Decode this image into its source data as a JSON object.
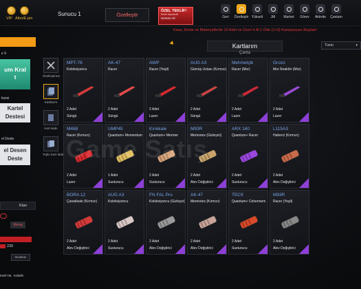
{
  "topbar": {
    "vip_label": "VIP",
    "currency_label": "Altın/E-pin",
    "server": "Sunucu 1",
    "customize": "Özelleştir",
    "offer": {
      "title": "ÖZEL TEKLİF!",
      "subtitle": "Kısıtlı Kapsamlı!",
      "action": "Hemen Al!"
    },
    "nav": [
      {
        "label": "Geri",
        "icon": "back-icon"
      },
      {
        "label": "Özelleştir",
        "icon": "crossed-tools-icon"
      },
      {
        "label": "Yükselt",
        "icon": "upgrade-icon"
      },
      {
        "label": "JM",
        "icon": "jm-icon"
      },
      {
        "label": "Market",
        "icon": "market-icon"
      },
      {
        "label": "Görev",
        "icon": "quest-icon"
      },
      {
        "label": "Aktivite",
        "icon": "activity-icon"
      },
      {
        "label": "Çantam",
        "icon": "bag-icon"
      }
    ]
  },
  "left": {
    "header_label": "e 9",
    "tile1": [
      "um Kral",
      "t"
    ],
    "section1": "ksesi",
    "tile2": [
      "Kartel",
      "Destesi"
    ],
    "section2": "el Deste",
    "tile3": [
      "el Desen",
      "Deste"
    ],
    "clan": "Klan",
    "message": "Mesaj",
    "stat1": "230",
    "stat2": "ÖLÜM M.",
    "foot1": "Katil Yar.",
    "foot2": "Kobelit"
  },
  "sidebar": [
    {
      "label": "Özelleştirme",
      "icon": "crossed-tools-icon"
    },
    {
      "label": "Kartlarım",
      "icon": "cards-icon"
    },
    {
      "label": "Kart kade",
      "icon": "card-trade-icon"
    },
    {
      "label": "Toplu Kart İade",
      "icon": "bulk-return-icon"
    }
  ],
  "main": {
    "promo": "Kasa, Deste ve Materyallerde 10 Adet ve Üzeri 4 Al 1 Öde (1+3) Kampanyası Başladı!",
    "title": "Kartlarım",
    "subtitle": "Çanta",
    "sort": "Tümü"
  },
  "cards": [
    {
      "name": "MPT-76",
      "tier": "Koleksiyoncu",
      "count": "2 Adet",
      "type": "Süngü",
      "color": "#d83a3a"
    },
    {
      "name": "AK-47",
      "tier": "Racer",
      "count": "2 Adet",
      "type": "Süngü",
      "color": "#e04a4a"
    },
    {
      "name": "AWP",
      "tier": "Racer (Yeşil)",
      "count": "2 Adet",
      "type": "Lazer",
      "color": "#d8282e"
    },
    {
      "name": "AUG A3",
      "tier": "Gümüş Ustası (Kırmızı)",
      "count": "2 Adet",
      "type": "Süngü",
      "color": "#c44"
    },
    {
      "name": "Mehmetçik",
      "tier": "Racer (Mor)",
      "count": "2 Adet",
      "type": "Lazer",
      "color": "#d3283a"
    },
    {
      "name": "Grozo",
      "tier": "Mor Reaktör (Mor)",
      "count": "2 Adet",
      "type": "Lazer",
      "color": "#9a4ad8"
    },
    {
      "name": "M468",
      "tier": "Racer (Kırmızı)",
      "count": "2 Adet",
      "type": "Lazer",
      "color": "#d8282e"
    },
    {
      "name": "UMP45",
      "tier": "Quantum+ Momentum",
      "count": "1 Adet",
      "type": "Susturucu",
      "color": "#e3c060"
    },
    {
      "name": "Kırıkkale",
      "tier": "Quantum+ Mermer",
      "count": "2 Adet",
      "type": "Susturucu",
      "color": "#d9a57a"
    },
    {
      "name": "M93R",
      "tier": "Memories (Gizleyici)",
      "count": "2 Adet",
      "type": "Alev Değiştirici",
      "color": "#c9a46a"
    },
    {
      "name": "ARX 160",
      "tier": "Quantum+ Racer",
      "count": "2 Adet",
      "type": "Susturucu",
      "color": "#9b47e0"
    },
    {
      "name": "L115A3",
      "tier": "Haberci (Kırmızı)",
      "count": "2 Adet",
      "type": "Alev Değiştirici",
      "color": "#c96a4a"
    },
    {
      "name": "BORA 12",
      "tier": "Çanakkale (Kırmızı)",
      "count": "2 Adet",
      "type": "Alev Değiştirici",
      "color": "#d53a3a"
    },
    {
      "name": "AUG A3",
      "tier": "Koleksiyoncu",
      "count": "2 Adet",
      "type": "Susturucu",
      "color": "#d9c8c8"
    },
    {
      "name": "FN FAL Pro",
      "tier": "Koleksiyoncu (Gizleyici)",
      "count": "2 Adet",
      "type": "Alev Değiştirici",
      "color": "#9a9a9a"
    },
    {
      "name": "AK-47",
      "tier": "Memories (Kırmızı)",
      "count": "2 Adet",
      "type": "Alev Değiştirici",
      "color": "#c9a49a"
    },
    {
      "name": "TEC9",
      "tier": "Quantum+ Cehennem",
      "count": "2 Adet",
      "type": "Susturucu",
      "color": "#d84a2a"
    },
    {
      "name": "M93R",
      "tier": "Racer (Yeşil)",
      "count": "2 Adet",
      "type": "Alev Değiştirici",
      "color": "#888"
    }
  ],
  "watermark": "Game Satış"
}
